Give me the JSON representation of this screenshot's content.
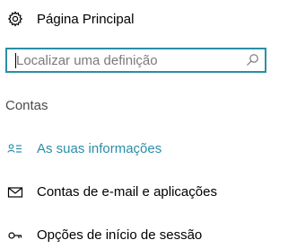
{
  "home": {
    "label": "Página Principal",
    "icon": "gear-icon"
  },
  "search": {
    "placeholder": "Localizar uma definição",
    "value": "",
    "icon": "search-icon",
    "accent": "#2a8ea8"
  },
  "section": {
    "title": "Contas"
  },
  "nav": {
    "items": [
      {
        "label": "As suas informações",
        "icon": "person-card-icon",
        "selected": true
      },
      {
        "label": "Contas de e-mail e aplicações",
        "icon": "mail-icon",
        "selected": false
      },
      {
        "label": "Opções de início de sessão",
        "icon": "key-icon",
        "selected": false
      }
    ],
    "accent_color": "#2a8ea8"
  }
}
